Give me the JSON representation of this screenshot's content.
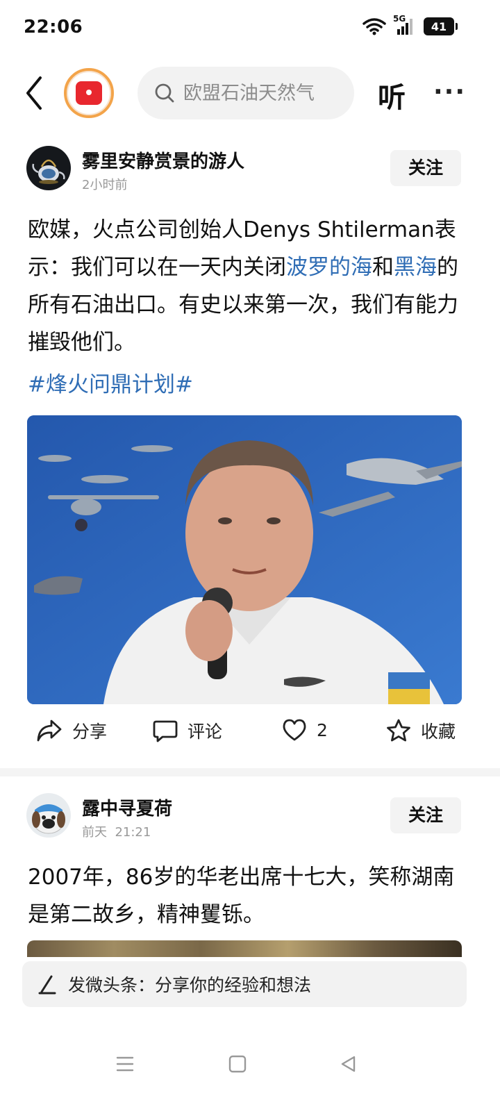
{
  "status_bar": {
    "time": "22:06",
    "network": "5G",
    "battery": "41"
  },
  "top_bar": {
    "search_placeholder": "欧盟石油天然气",
    "listen_label": "听",
    "more_label": "···"
  },
  "posts": [
    {
      "author": "雾里安静赏景的游人",
      "time": "2小时前",
      "follow_label": "关注",
      "content": {
        "part1": "欧媒，火点公司创始人Denys Shtilerman表示：我们可以在一天内关闭",
        "link1": "波罗的海",
        "part2": "和",
        "link2": "黑海",
        "part3": "的所有石油出口。有史以来第一次，我们有能力摧毁他们。"
      },
      "topic": "#烽火问鼎计划#",
      "actions": {
        "share": "分享",
        "comment": "评论",
        "likes": "2",
        "favorite": "收藏"
      }
    },
    {
      "author": "露中寻夏荷",
      "time": "前天  21:21",
      "follow_label": "关注",
      "content": "2007年，86岁的华老出席十七大，笑称湖南是第二故乡，精神矍铄。"
    }
  ],
  "compose": {
    "label": "发微头条：分享你的经验和想法"
  },
  "colors": {
    "link": "#2f6db5",
    "accent": "#e8272e",
    "logo_ring": "#f3a44a"
  }
}
